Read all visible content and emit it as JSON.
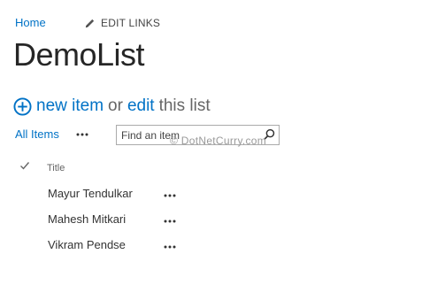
{
  "breadcrumb": {
    "home_label": "Home",
    "edit_links_label": "EDIT LINKS"
  },
  "page": {
    "title": "DemoList"
  },
  "actions": {
    "new_item_label": "new item",
    "or_label": "or",
    "edit_label": "edit",
    "this_list_label": "this list"
  },
  "view": {
    "current_view_label": "All Items"
  },
  "search": {
    "placeholder": "Find an item"
  },
  "watermark": {
    "text": "© DotNetCurry.com"
  },
  "list": {
    "columns": {
      "title": "Title"
    },
    "rows": [
      {
        "title": "Mayur Tendulkar"
      },
      {
        "title": "Mahesh Mitkari"
      },
      {
        "title": "Vikram Pendse"
      }
    ]
  },
  "icons": {
    "edit": "pencil-icon",
    "add": "plus-circle-icon",
    "more": "ellipsis-icon",
    "search": "search-icon",
    "select": "checkmark-icon"
  },
  "colors": {
    "link": "#0072c6",
    "title": "#262626",
    "text": "#444444"
  }
}
